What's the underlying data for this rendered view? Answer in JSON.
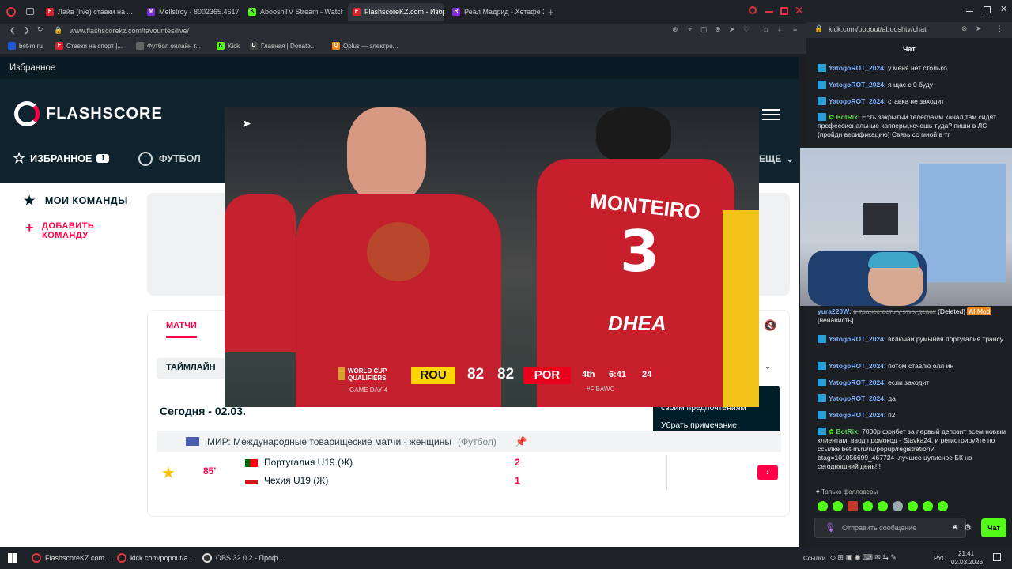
{
  "tabs": [
    {
      "label": "Лайв (live) ставки на ..."
    },
    {
      "label": "Mellstroy - 8002365.4617"
    },
    {
      "label": "AbooshTV Stream - Watch"
    },
    {
      "label": "FlashscoreKZ.com - Избр..."
    },
    {
      "label": "Реал Мадрид - Хетафе 20..."
    }
  ],
  "address": "www.flashscorekz.com/favourites/live/",
  "bookmarks": [
    "bet-m.ru",
    "Ставки на спорт |...",
    "Футбол онлайн т...",
    "Kick",
    "Главная | Donate...",
    "Qplus — электро..."
  ],
  "fs": {
    "sub_title": "Избранное",
    "logo": "FLASHSCORE",
    "nav_favorites": "ИЗБРАННОЕ",
    "nav_fav_count": "1",
    "nav_football": "ФУТБОЛ",
    "nav_more": "ЕЩЕ",
    "my_teams": "МОИ КОМАНДЫ",
    "add_team_l1": "ДОБАВИТЬ",
    "add_team_l2": "КОМАНДУ",
    "tab_matches": "МАТЧИ",
    "timeline": "ТАЙМЛАЙН",
    "today": "Сегодня - 02.03.",
    "popup_l1": "своим предпочтениям",
    "popup_l2": "Убрать примечание",
    "league": "МИР: Международные товарищеские матчи - женщины",
    "league_sport": "(Футбол)",
    "minute": "85'",
    "home": "Португалия U19 (Ж)",
    "away": "Чехия U19 (Ж)",
    "home_score": "2",
    "away_score": "1"
  },
  "video": {
    "event_l1": "WORLD CUP",
    "event_l2": "QUALIFIERS",
    "game_day": "GAME DAY 4",
    "team_a": "ROU",
    "score_a": "82",
    "score_b": "82",
    "team_b": "POR",
    "quarter": "4th",
    "clock": "6:41",
    "shot": "24",
    "tag": "#FIBAWC",
    "jersey_name": "MONTEIRO",
    "jersey_num": "3",
    "sponsor": "DHEA"
  },
  "chat": {
    "address": "kick.com/popout/abooshtv/chat",
    "title": "Чат",
    "messages_top": [
      {
        "user": "YatogoROT_2024:",
        "text": "у меня нет столько"
      },
      {
        "user": "YatogoROT_2024:",
        "text": "я щас с 0 буду"
      },
      {
        "user": "YatogoROT_2024:",
        "text": "ставка не заходит"
      }
    ],
    "bot1_user": "BotRix:",
    "bot1_text": "Есть закрытый телеграмм канал,там сидят профессиональные капперы,хочешь туда? пиши в ЛС (пройди верификацию) Связь со мной в тг",
    "yura_user": "yura220W:",
    "yura_text": "в трансе есть у этих девок",
    "yura_deleted": "(Deleted)",
    "yura_badge": "AI Mod",
    "yura_tag": "[ненависть]",
    "messages_bottom": [
      {
        "user": "YatogoROT_2024:",
        "text": "включай румыния португалия трансу"
      },
      {
        "user": "YatogoROT_2024:",
        "text": "потом ставлю олл ин"
      },
      {
        "user": "YatogoROT_2024:",
        "text": "если заходит"
      },
      {
        "user": "YatogoROT_2024:",
        "text": "да"
      },
      {
        "user": "YatogoROT_2024:",
        "text": "п2"
      }
    ],
    "bot2_user": "BotRix:",
    "bot2_text": "7000р фрибет за первый депозит всем новым клиентам, ввод промокод - Stavka24, и регистрируйте по ссылке bet-m.ru/ru/popup/registration?btag=101056699_467724 ,лучшее цуписное БК на сегодняшний день!!!",
    "followers_only": "Только фолловеры",
    "input_placeholder": "Отправить сообщение",
    "send": "Чат"
  },
  "taskbar": {
    "app1": "FlashscoreKZ.com ...",
    "app2": "kick.com/popout/a...",
    "app3": "OBS 32.0.2 - Проф...",
    "links": "Ссылки",
    "lang": "РУС",
    "time": "21:41",
    "date": "02.03.2026"
  }
}
